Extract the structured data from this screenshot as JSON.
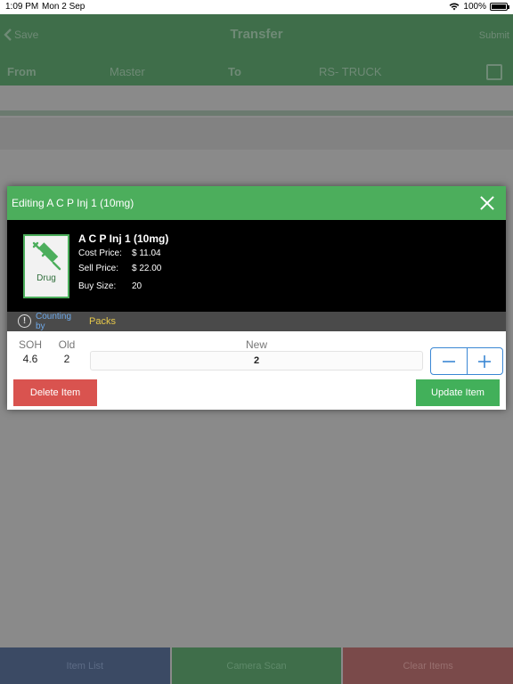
{
  "status_bar": {
    "time": "1:09 PM",
    "date": "Mon 2 Sep",
    "battery": "100%"
  },
  "nav": {
    "back_label": "Save",
    "title": "Transfer",
    "submit_label": "Submit"
  },
  "route": {
    "from_label": "From",
    "from_value": "Master",
    "to_label": "To",
    "to_value": "RS- TRUCK"
  },
  "bottom_tabs": {
    "item_list": "Item List",
    "camera_scan": "Camera Scan",
    "clear_items": "Clear Items"
  },
  "modal": {
    "title": "Editing A C P Inj 1 (10mg)",
    "product": {
      "category": "Drug",
      "name": "A C P Inj 1 (10mg)",
      "cost_label": "Cost Price:",
      "cost_value": "$ 11.04",
      "sell_label": "Sell Price:",
      "sell_value": "$ 22.00",
      "buy_label": "Buy Size:",
      "buy_value": "20"
    },
    "counting": {
      "label": "Counting by",
      "value": "Packs"
    },
    "quantity": {
      "soh_label": "SOH",
      "soh_value": "4.6",
      "old_label": "Old",
      "old_value": "2",
      "new_label": "New",
      "new_value": "2"
    },
    "delete_label": "Delete Item",
    "update_label": "Update Item"
  },
  "colors": {
    "header_green": "#4cae5c",
    "delete_red": "#d9534f",
    "update_green": "#42b05a",
    "stepper_blue": "#3a87d4",
    "packs_yellow": "#e6c84a"
  }
}
